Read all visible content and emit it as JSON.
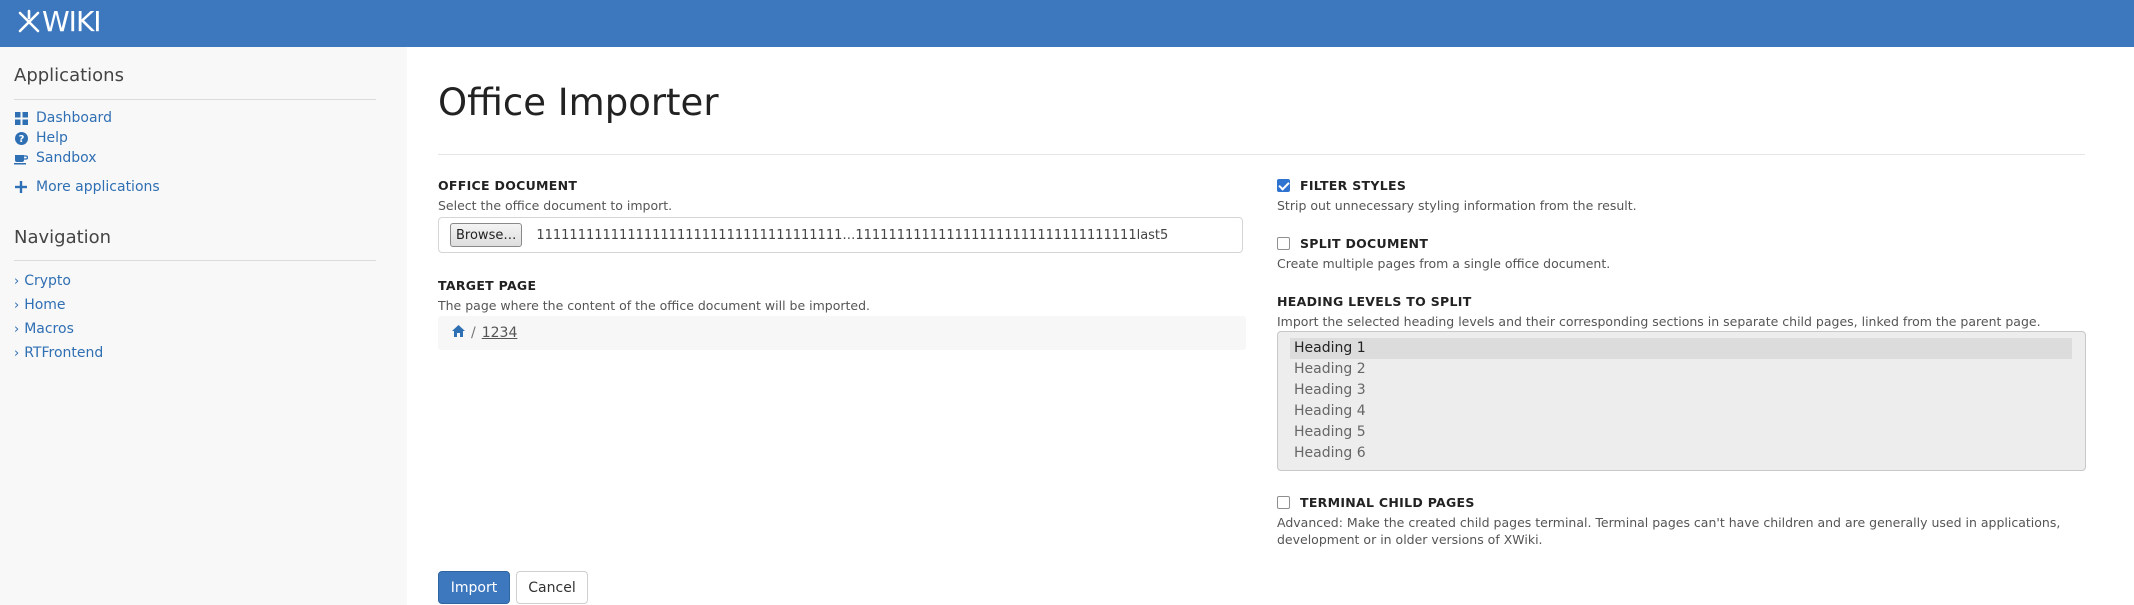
{
  "header": {
    "logo_text": "WIKI",
    "brand_color": "#3d78bf"
  },
  "sidebar": {
    "applications_title": "Applications",
    "applications": [
      {
        "label": "Dashboard",
        "icon": "dashboard-icon"
      },
      {
        "label": "Help",
        "icon": "help-icon"
      },
      {
        "label": "Sandbox",
        "icon": "coffee-icon"
      }
    ],
    "more_applications": {
      "label": "More applications",
      "icon": "plus-icon"
    },
    "navigation_title": "Navigation",
    "navigation": [
      {
        "label": "Crypto"
      },
      {
        "label": "Home"
      },
      {
        "label": "Macros"
      },
      {
        "label": "RTFrontend"
      }
    ]
  },
  "main": {
    "title": "Office Importer",
    "office_document": {
      "label": "OFFICE DOCUMENT",
      "hint": "Select the office document to import.",
      "browse_label": "Browse…",
      "file_name": "1111111111111111111111111111111111111…1111111111111111111111111111111111last5"
    },
    "target_page": {
      "label": "TARGET PAGE",
      "hint": "The page where the content of the office document will be imported.",
      "separator": "/",
      "page": "1234"
    },
    "filter_styles": {
      "label": "FILTER STYLES",
      "hint": "Strip out unnecessary styling information from the result.",
      "checked": true
    },
    "split_document": {
      "label": "SPLIT DOCUMENT",
      "hint": "Create multiple pages from a single office document.",
      "checked": false
    },
    "heading_levels": {
      "label": "HEADING LEVELS TO SPLIT",
      "hint": "Import the selected heading levels and their corresponding sections in separate child pages, linked from the parent page.",
      "options": [
        "Heading 1",
        "Heading 2",
        "Heading 3",
        "Heading 4",
        "Heading 5",
        "Heading 6"
      ],
      "selected": "Heading 1"
    },
    "terminal_child_pages": {
      "label": "TERMINAL CHILD PAGES",
      "hint_line1": "Advanced: Make the created child pages terminal. Terminal pages can't have children and are generally used in applications,",
      "hint_line2": "development or in older versions of XWiki.",
      "checked": false
    },
    "import_label": "Import",
    "cancel_label": "Cancel"
  }
}
